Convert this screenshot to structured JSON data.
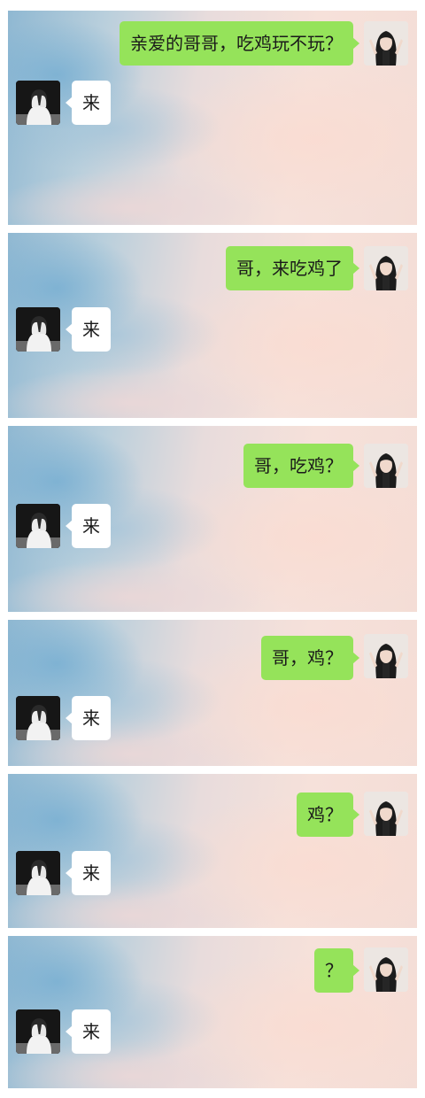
{
  "conversations": [
    {
      "sent": "亲爱的哥哥，吃鸡玩不玩？",
      "reply": "来"
    },
    {
      "sent": "哥，来吃鸡了",
      "reply": "来"
    },
    {
      "sent": "哥，吃鸡？",
      "reply": "来"
    },
    {
      "sent": "哥，鸡？",
      "reply": "来"
    },
    {
      "sent": "鸡？",
      "reply": "来"
    },
    {
      "sent": "？",
      "reply": "来"
    }
  ],
  "icons": {
    "sender_avatar": "girl-avatar-icon",
    "receiver_avatar": "boy-avatar-icon"
  },
  "colors": {
    "sent_bubble": "#95e35a",
    "received_bubble": "#ffffff"
  }
}
